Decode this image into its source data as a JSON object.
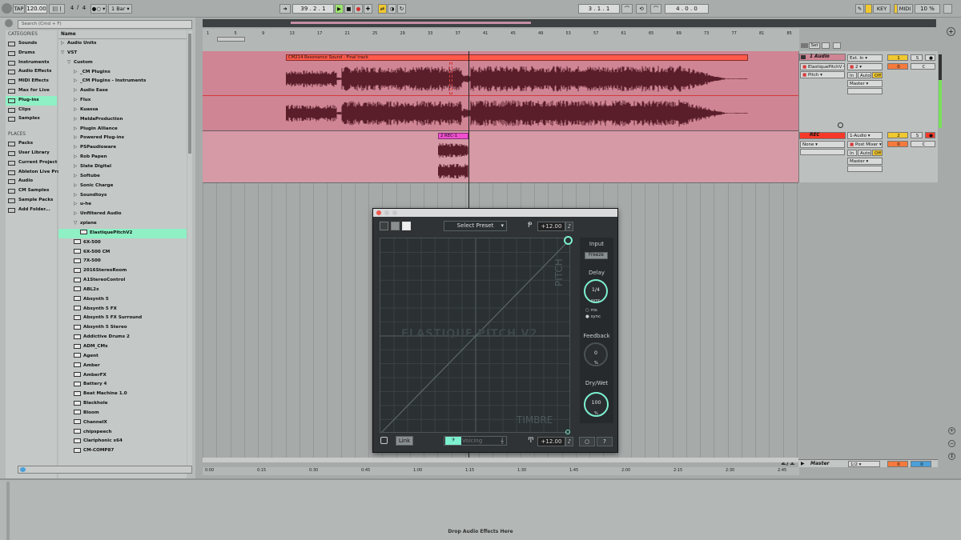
{
  "toolbar": {
    "tap": "TAP",
    "tempo": "120.00",
    "sig_num": "4",
    "sig_den": "4",
    "quant": "1 Bar",
    "pos": "39 .  2 .  1",
    "loop_start": "3 .  1 .  1",
    "loop_len": "4 .  0 .  0",
    "key": "KEY",
    "midi": "MIDI",
    "cpu": "10 %"
  },
  "browser": {
    "search_placeholder": "Search (Cmd + F)",
    "categories_header": "CATEGORIES",
    "categories": [
      "Sounds",
      "Drums",
      "Instruments",
      "Audio Effects",
      "MIDI Effects",
      "Max for Live",
      "Plug-ins",
      "Clips",
      "Samples"
    ],
    "places_header": "PLACES",
    "places": [
      "Packs",
      "User Library",
      "Current Project",
      "Ableton Live Pro",
      "Audio",
      "CM Samples",
      "Sample Packs",
      "Add Folder..."
    ],
    "name_header": "Name",
    "tree": [
      {
        "d": 0,
        "a": "▷",
        "t": "Audio Units"
      },
      {
        "d": 0,
        "a": "▽",
        "t": "VST"
      },
      {
        "d": 1,
        "a": "▽",
        "t": "Custom"
      },
      {
        "d": 2,
        "a": "▷",
        "t": "_CM Plugins"
      },
      {
        "d": 2,
        "a": "▷",
        "t": "_CM Plugins - Instruments"
      },
      {
        "d": 2,
        "a": "▷",
        "t": "Audio Ease"
      },
      {
        "d": 2,
        "a": "▷",
        "t": "Flux"
      },
      {
        "d": 2,
        "a": "▷",
        "t": "Kuassa"
      },
      {
        "d": 2,
        "a": "▷",
        "t": "MeldaProduction"
      },
      {
        "d": 2,
        "a": "▷",
        "t": "Plugin Alliance"
      },
      {
        "d": 2,
        "a": "▷",
        "t": "Powered Plug-ins"
      },
      {
        "d": 2,
        "a": "▷",
        "t": "PSPaudioware"
      },
      {
        "d": 2,
        "a": "▷",
        "t": "Rob Papen"
      },
      {
        "d": 2,
        "a": "▷",
        "t": "Slate Digital"
      },
      {
        "d": 2,
        "a": "▷",
        "t": "Softube"
      },
      {
        "d": 2,
        "a": "▷",
        "t": "Sonic Charge"
      },
      {
        "d": 2,
        "a": "▷",
        "t": "Soundtoys"
      },
      {
        "d": 2,
        "a": "▷",
        "t": "u-he"
      },
      {
        "d": 2,
        "a": "▷",
        "t": "Unfiltered Audio"
      },
      {
        "d": 2,
        "a": "▽",
        "t": "zplane"
      },
      {
        "d": 3,
        "a": "",
        "t": "ElastiquePitchV2",
        "box": true,
        "sel": true
      },
      {
        "d": 2,
        "a": "",
        "t": "6X-500",
        "box": true
      },
      {
        "d": 2,
        "a": "",
        "t": "6X-500 CM",
        "box": true
      },
      {
        "d": 2,
        "a": "",
        "t": "7X-500",
        "box": true
      },
      {
        "d": 2,
        "a": "",
        "t": "2016StereoRoom",
        "box": true
      },
      {
        "d": 2,
        "a": "",
        "t": "A1StereoControl",
        "box": true
      },
      {
        "d": 2,
        "a": "",
        "t": "ABL2x",
        "box": true
      },
      {
        "d": 2,
        "a": "",
        "t": "Absynth 5",
        "box": true
      },
      {
        "d": 2,
        "a": "",
        "t": "Absynth 5 FX",
        "box": true
      },
      {
        "d": 2,
        "a": "",
        "t": "Absynth 5 FX Surround",
        "box": true
      },
      {
        "d": 2,
        "a": "",
        "t": "Absynth 5 Stereo",
        "box": true
      },
      {
        "d": 2,
        "a": "",
        "t": "Addictive Drums 2",
        "box": true
      },
      {
        "d": 2,
        "a": "",
        "t": "ADM_CMx",
        "box": true
      },
      {
        "d": 2,
        "a": "",
        "t": "Agent",
        "box": true
      },
      {
        "d": 2,
        "a": "",
        "t": "Amber",
        "box": true
      },
      {
        "d": 2,
        "a": "",
        "t": "AmberFX",
        "box": true
      },
      {
        "d": 2,
        "a": "",
        "t": "Battery 4",
        "box": true
      },
      {
        "d": 2,
        "a": "",
        "t": "Beat Machine 1.0",
        "box": true
      },
      {
        "d": 2,
        "a": "",
        "t": "Blackhole",
        "box": true
      },
      {
        "d": 2,
        "a": "",
        "t": "Bloom",
        "box": true
      },
      {
        "d": 2,
        "a": "",
        "t": "ChannelX",
        "box": true
      },
      {
        "d": 2,
        "a": "",
        "t": "chipspeech",
        "box": true
      },
      {
        "d": 2,
        "a": "",
        "t": "Clariphonic x64",
        "box": true
      },
      {
        "d": 2,
        "a": "",
        "t": "CM-COMP87",
        "box": true
      }
    ]
  },
  "arrangement": {
    "bar_marks": [
      "1",
      "5",
      "9",
      "13",
      "17",
      "21",
      "25",
      "29",
      "33",
      "37",
      "41",
      "45",
      "49",
      "53",
      "57",
      "61",
      "65",
      "69",
      "73",
      "77",
      "81",
      "85"
    ],
    "time_marks": [
      "0:00",
      "0:15",
      "0:30",
      "0:45",
      "1:00",
      "1:15",
      "1:30",
      "1:45",
      "2:00",
      "2:15",
      "2:30",
      "2:45"
    ],
    "clip1": "CM214 Resonance Sound - Final track",
    "clip2": "2 REC-1",
    "set_label": "Set",
    "page": "2/1"
  },
  "mixer": {
    "t1": {
      "name": "1 Audio",
      "dev1": "ElastiquePitchV",
      "dev2": "Pitch",
      "in": "Ext. In",
      "ch": "2",
      "out": "Master",
      "num": "1",
      "vol": "0",
      "pan": "C"
    },
    "t2": {
      "name": "REC",
      "dev1": "None",
      "in": "1-Audio",
      "ch": "Post Mixer",
      "out": "Master",
      "num": "2",
      "vol": "0",
      "pan": "C"
    },
    "io": {
      "in": "In",
      "auto": "Auto",
      "off": "Off"
    },
    "master": {
      "name": "Master",
      "ch": "1/2",
      "vol": "0",
      "pan": "0"
    }
  },
  "plugin": {
    "preset": "Select Preset",
    "pitch_top": "+12.00",
    "pitch_bottom": "+12.00",
    "input": "Input",
    "freeze": "Freeze",
    "delay": "Delay",
    "delay_val": "1/4",
    "delay_unit": "sync",
    "ms": "ms",
    "sync": "sync",
    "feedback": "Feedback",
    "fb_val": "0",
    "fb_unit": "%",
    "drywet": "Dry/Wet",
    "dw_val": "100",
    "dw_unit": "%",
    "pitch_axis": "PITCH",
    "timbre_axis": "TIMBRE",
    "watermark": "ELASTIQUE PITCH V2",
    "link": "Link",
    "voicing": "Voicing",
    "help": "?"
  },
  "dropzone": "Drop Audio Effects Here"
}
